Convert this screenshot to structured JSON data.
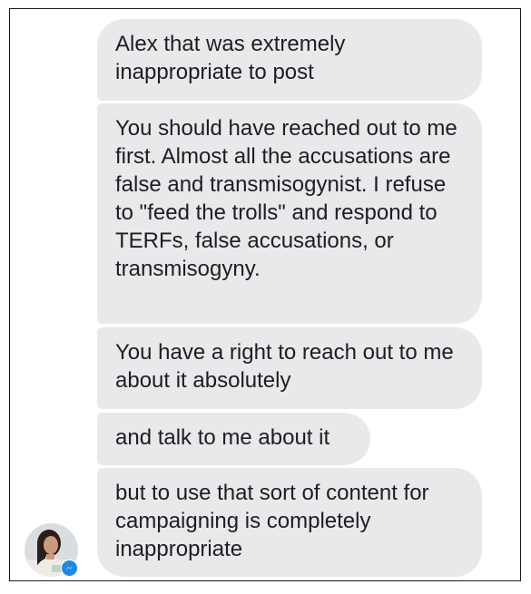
{
  "conversation": {
    "messages": [
      {
        "text": "Alex that was extremely inappropriate to post"
      },
      {
        "text": "You should have reached out to me first. Almost all the accusations are false and transmisogynist. I refuse to \"feed the trolls\" and respond to TERFs, false accusations, or transmisogyny."
      },
      {
        "text": "You have a right to reach out to me about it absolutely"
      },
      {
        "text": "and talk to me about it"
      },
      {
        "text": "but to use that sort of content for campaigning is completely inappropriate"
      }
    ],
    "sender": {
      "avatar_icon": "profile-photo",
      "badge_icon": "messenger-icon"
    }
  },
  "colors": {
    "bubble_bg": "#e9e9eb",
    "bubble_text": "#1c1e21",
    "messenger_blue": "#1e88e5"
  }
}
